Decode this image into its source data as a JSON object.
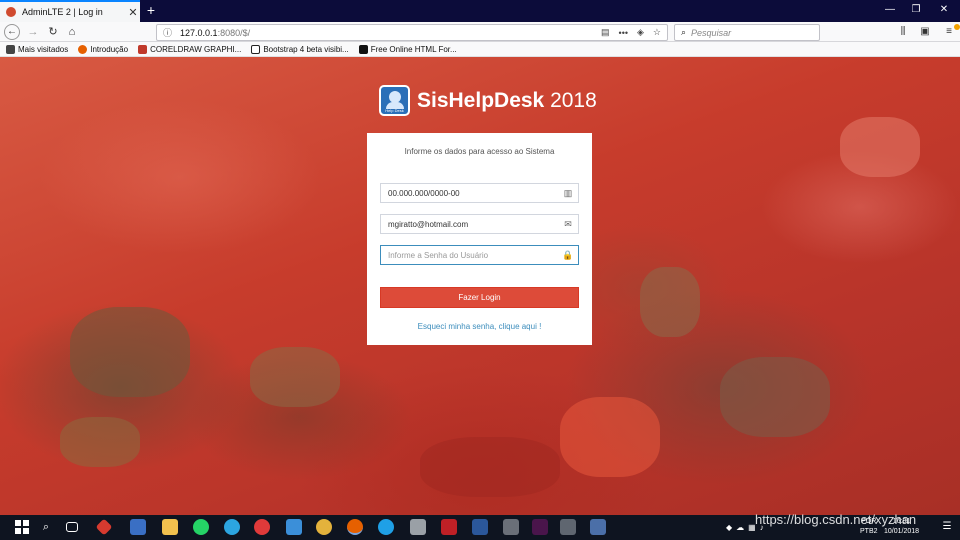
{
  "browser": {
    "tab_title": "AdminLTE 2 | Log in",
    "url_host": "127.0.0.1",
    "url_rest": ":8080/$/",
    "search_placeholder": "Pesquisar",
    "bookmarks": [
      {
        "label": "Mais visitados",
        "icon": "gear-icon",
        "color": "#444444"
      },
      {
        "label": "Introdução",
        "icon": "firefox-icon",
        "color": "#e66000"
      },
      {
        "label": "CORELDRAW GRAPHI...",
        "icon": "coreldraw-icon",
        "color": "#c0392b"
      },
      {
        "label": "Bootstrap 4 beta visibi...",
        "icon": "c-logo-icon",
        "color": "#222222"
      },
      {
        "label": "Free Online HTML For...",
        "icon": "ff-logo-icon",
        "color": "#111111"
      }
    ]
  },
  "app": {
    "logo_bold": "SisHelpDesk",
    "logo_year": "2018",
    "logo_caption": "Help Desk",
    "login_message": "Informe os dados para acesso ao Sistema",
    "cnpj_value": "00.000.000/0000-00",
    "email_value": "mgiratto@hotmail.com",
    "password_placeholder": "Informe a Senha do Usuário",
    "login_button": "Fazer Login",
    "forgot_link": "Esqueci minha senha, clique aqui !"
  },
  "taskbar": {
    "language": "POR",
    "language_sub": "PTB2",
    "time": "16:01",
    "date": "10/01/2018",
    "watermark": "https://blog.csdn.net/xyzhan",
    "apps": [
      {
        "name": "start-icon",
        "color": "#ffffff"
      },
      {
        "name": "search-icon",
        "color": "#ffffff"
      },
      {
        "name": "task-view-icon",
        "color": "#ffffff"
      },
      {
        "name": "app-red-icon",
        "color": "#d63a2f"
      },
      {
        "name": "app-user-icon",
        "color": "#3a6fc4"
      },
      {
        "name": "file-explorer-icon",
        "color": "#f2c14e"
      },
      {
        "name": "whatsapp-icon",
        "color": "#25d366"
      },
      {
        "name": "telegram-icon",
        "color": "#2ca5e0"
      },
      {
        "name": "dx-icon",
        "color": "#e03a3a"
      },
      {
        "name": "app-blue-icon",
        "color": "#3b8fd9"
      },
      {
        "name": "chrome-icon",
        "color": "#e3b23c"
      },
      {
        "name": "firefox-icon",
        "color": "#e66000"
      },
      {
        "name": "ie-icon",
        "color": "#1fa0e6"
      },
      {
        "name": "app-window-icon",
        "color": "#9aa0a6"
      },
      {
        "name": "filezilla-icon",
        "color": "#bf2026"
      },
      {
        "name": "word-icon",
        "color": "#2b579a"
      },
      {
        "name": "app-gray-icon",
        "color": "#6a6f78"
      },
      {
        "name": "slack-icon",
        "color": "#4a154b"
      },
      {
        "name": "app-usb-icon",
        "color": "#5f6670"
      },
      {
        "name": "app-monitor-icon",
        "color": "#4b6fa8"
      }
    ]
  }
}
